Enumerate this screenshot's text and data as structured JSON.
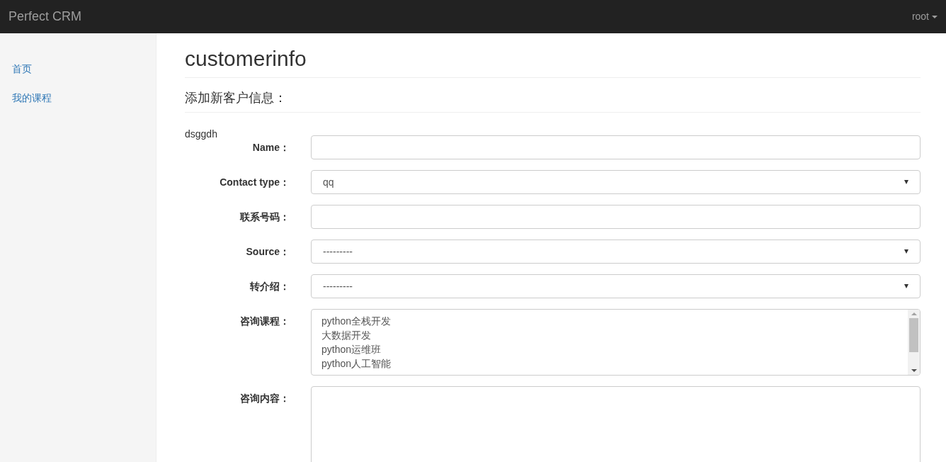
{
  "navbar": {
    "brand": "Perfect CRM",
    "user": "root"
  },
  "sidebar": {
    "items": [
      {
        "label": "首页"
      },
      {
        "label": "我的课程"
      }
    ]
  },
  "page_title": "customerinfo",
  "subtitle": "添加新客户信息：",
  "note": "dsggdh",
  "form": {
    "fields": [
      {
        "kind": "text",
        "label": "Name："
      },
      {
        "kind": "select",
        "label": "Contact type：",
        "value": "qq"
      },
      {
        "kind": "text",
        "label": "联系号码："
      },
      {
        "kind": "select",
        "label": "Source：",
        "value": "---------"
      },
      {
        "kind": "select",
        "label": "转介绍：",
        "value": "---------"
      },
      {
        "kind": "multiselect",
        "label": "咨询课程：",
        "options": [
          "python全栈开发",
          "大数据开发",
          "python运维班",
          "python人工智能"
        ]
      },
      {
        "kind": "textarea",
        "label": "咨询内容："
      }
    ]
  }
}
